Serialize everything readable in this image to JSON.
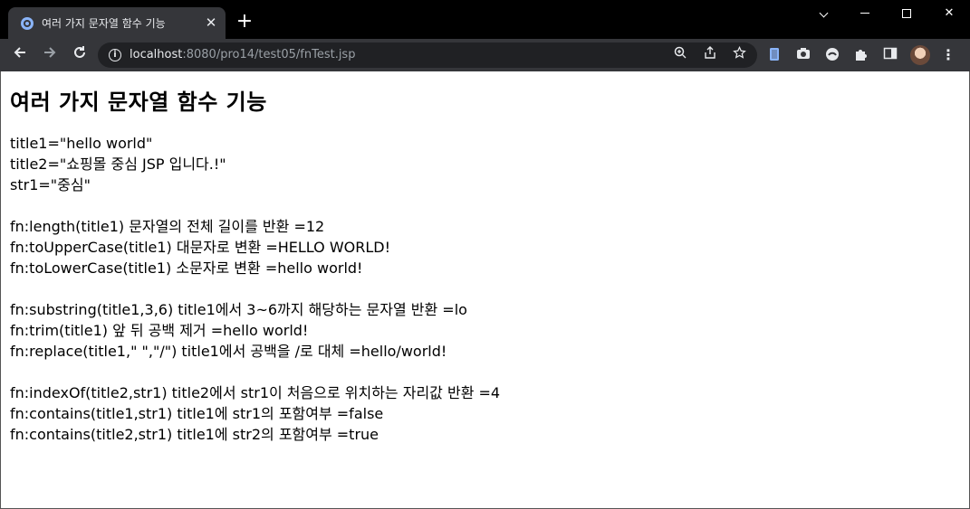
{
  "browser": {
    "tab_title": "여러 가지 문자열 함수 기능",
    "tab_close": "✕",
    "new_tab": "+",
    "url_host": "localhost",
    "url_path": ":8080/pro14/test05/fnTest.jsp"
  },
  "page": {
    "heading": "여러 가지 문자열 함수 기능",
    "vars": [
      "title1=\"hello world\"",
      "title2=\"쇼핑몰 중심 JSP 입니다.!\"",
      "str1=\"중심\""
    ],
    "group1": [
      "fn:length(title1) 문자열의 전체 길이를 반환 =12",
      "fn:toUpperCase(title1) 대문자로 변환 =HELLO WORLD!",
      "fn:toLowerCase(title1) 소문자로 변환 =hello world!"
    ],
    "group2": [
      "fn:substring(title1,3,6) title1에서 3~6까지 해당하는 문자열 반환 =lo",
      "fn:trim(title1) 앞 뒤 공백 제거 =hello world!",
      "fn:replace(title1,\" \",\"/\") title1에서 공백을 /로 대체 =hello/world!"
    ],
    "group3": [
      "fn:indexOf(title2,str1) title2에서 str1이 처음으로 위치하는 자리값 반환 =4",
      "fn:contains(title1,str1) title1에 str1의 포함여부 =false",
      "fn:contains(title2,str1) title1에 str2의 포함여부 =true"
    ]
  }
}
